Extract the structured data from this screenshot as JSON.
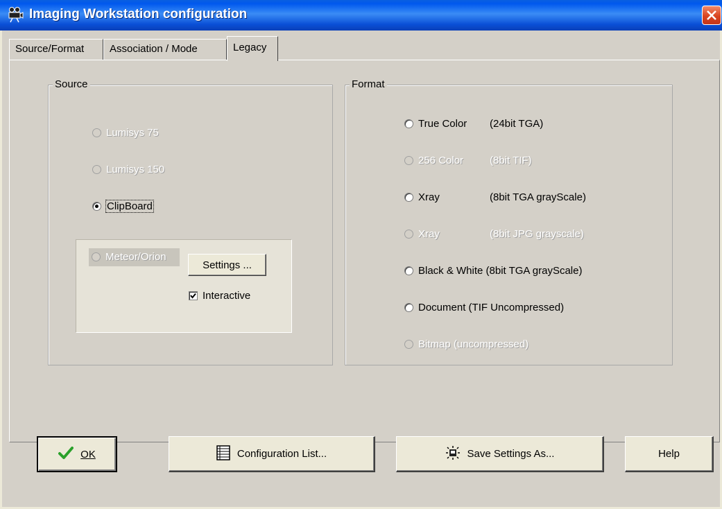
{
  "window": {
    "title": "Imaging Workstation configuration"
  },
  "tabs": [
    {
      "label": "Source/Format",
      "active": false
    },
    {
      "label": "Association / Mode",
      "active": false
    },
    {
      "label": "Legacy",
      "active": true
    }
  ],
  "source": {
    "legend": "Source",
    "options": [
      {
        "label": "Lumisys 75",
        "checked": false,
        "enabled": false
      },
      {
        "label": "Lumisys 150",
        "checked": false,
        "enabled": false
      },
      {
        "label": "ClipBoard",
        "checked": true,
        "enabled": true
      }
    ],
    "meteor": {
      "label": "Meteor/Orion",
      "enabled": false,
      "settings_button": "Settings ...",
      "interactive_label": "Interactive",
      "interactive_checked": true
    }
  },
  "format": {
    "legend": "Format",
    "options": [
      {
        "label": "True Color",
        "detail": "(24bit TGA)",
        "enabled": true,
        "checked": false
      },
      {
        "label": "256 Color",
        "detail": "(8bit TIF)",
        "enabled": false,
        "checked": false
      },
      {
        "label": "Xray",
        "detail": "(8bit TGA grayScale)",
        "enabled": true,
        "checked": false
      },
      {
        "label": "Xray",
        "detail": "(8bit JPG grayscale)",
        "enabled": false,
        "checked": false
      },
      {
        "label": "Black & White (8bit TGA grayScale)",
        "detail": "",
        "enabled": true,
        "checked": false
      },
      {
        "label": "Document (TIF Uncompressed)",
        "detail": "",
        "enabled": true,
        "checked": false
      },
      {
        "label": "Bitmap (uncompressed)",
        "detail": "",
        "enabled": false,
        "checked": false
      }
    ]
  },
  "buttons": {
    "ok": "OK",
    "config_list": "Configuration List...",
    "save_as": "Save Settings As...",
    "help": "Help"
  },
  "icons": {
    "app": "projector-icon",
    "close": "close-icon",
    "ok": "checkmark-icon",
    "config_list": "list-icon",
    "save_as": "save-settings-icon"
  },
  "colors": {
    "titlebar": "#0a5fe0",
    "close": "#d9441f",
    "checkmark": "#2aa02a"
  }
}
